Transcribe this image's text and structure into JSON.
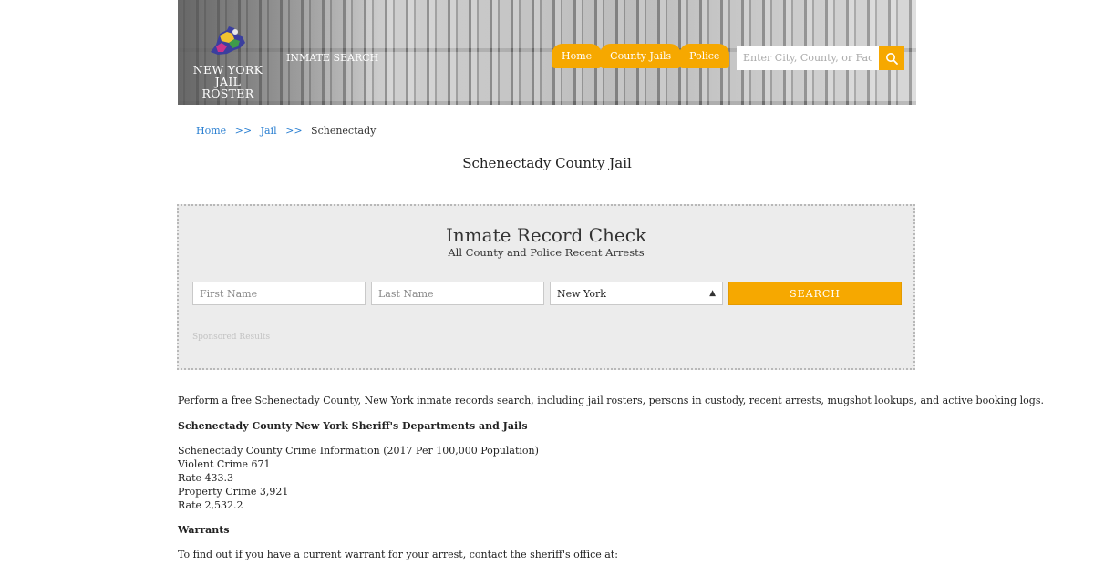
{
  "header": {
    "logo": {
      "line1": "NEW YORK",
      "line2": "JAIL ROSTER"
    },
    "inmate_search_link": "INMATE SEARCH",
    "nav": [
      {
        "label": "Home"
      },
      {
        "label": "County Jails"
      },
      {
        "label": "Police"
      }
    ],
    "search": {
      "placeholder": "Enter City, County, or Facility",
      "icon": "search-icon"
    }
  },
  "breadcrumb": {
    "items": [
      "Home",
      "Jail"
    ],
    "separator": ">>",
    "current": "Schenectady"
  },
  "page_title": "Schenectady County Jail",
  "record_check": {
    "title": "Inmate Record Check",
    "subtitle": "All County and Police Recent Arrests",
    "first_name_placeholder": "First Name",
    "last_name_placeholder": "Last Name",
    "state_selected": "New York",
    "search_label": "SEARCH",
    "sponsored": "Sponsored Results"
  },
  "content": {
    "intro": "Perform a free Schenectady County, New York inmate records search, including jail rosters, persons in custody, recent arrests, mugshot lookups, and active booking logs.",
    "departments_heading": "Schenectady County New York Sheriff's Departments and Jails",
    "crime_lines": [
      "Schenectady County Crime Information (2017 Per 100,000 Population)",
      "Violent Crime 671",
      "Rate 433.3",
      "Property Crime 3,921",
      "Rate 2,532.2"
    ],
    "warrants_heading": "Warrants",
    "warrants_text": "To find out if you have a current warrant for your arrest, contact the sheriff's office at:"
  },
  "colors": {
    "accent": "#f6a800",
    "link": "#2a7fd1",
    "panel_bg": "#ececec"
  }
}
